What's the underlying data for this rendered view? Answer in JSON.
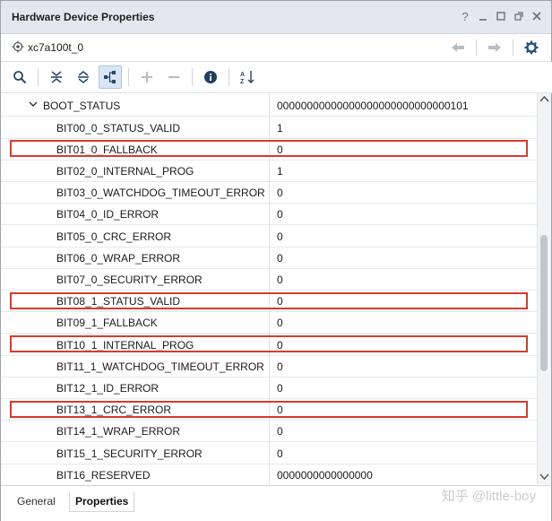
{
  "window": {
    "title": "Hardware Device Properties",
    "controls": [
      "?",
      "minimize",
      "restore",
      "float",
      "close"
    ],
    "controls_labels": {
      "help": "?"
    }
  },
  "device": {
    "name": "xc7a100t_0",
    "icon": "chip-icon"
  },
  "toolbar": {
    "buttons": [
      "search-icon",
      "collapse-all-icon",
      "expand-all-icon",
      "group-by-category-icon",
      "add-icon",
      "remove-icon",
      "info-icon",
      "sort-az-icon"
    ]
  },
  "properties": {
    "group": {
      "name": "BOOT_STATUS",
      "value": "00000000000000000000000000000101"
    },
    "rows": [
      {
        "name": "BIT00_0_STATUS_VALID",
        "value": "1",
        "highlighted": false
      },
      {
        "name": "BIT01_0_FALLBACK",
        "value": "0",
        "highlighted": true
      },
      {
        "name": "BIT02_0_INTERNAL_PROG",
        "value": "1",
        "highlighted": false
      },
      {
        "name": "BIT03_0_WATCHDOG_TIMEOUT_ERROR",
        "value": "0",
        "highlighted": false
      },
      {
        "name": "BIT04_0_ID_ERROR",
        "value": "0",
        "highlighted": false
      },
      {
        "name": "BIT05_0_CRC_ERROR",
        "value": "0",
        "highlighted": false
      },
      {
        "name": "BIT06_0_WRAP_ERROR",
        "value": "0",
        "highlighted": false
      },
      {
        "name": "BIT07_0_SECURITY_ERROR",
        "value": "0",
        "highlighted": false
      },
      {
        "name": "BIT08_1_STATUS_VALID",
        "value": "0",
        "highlighted": true
      },
      {
        "name": "BIT09_1_FALLBACK",
        "value": "0",
        "highlighted": false
      },
      {
        "name": "BIT10_1_INTERNAL_PROG",
        "value": "0",
        "highlighted": true
      },
      {
        "name": "BIT11_1_WATCHDOG_TIMEOUT_ERROR",
        "value": "0",
        "highlighted": false
      },
      {
        "name": "BIT12_1_ID_ERROR",
        "value": "0",
        "highlighted": false
      },
      {
        "name": "BIT13_1_CRC_ERROR",
        "value": "0",
        "highlighted": true
      },
      {
        "name": "BIT14_1_WRAP_ERROR",
        "value": "0",
        "highlighted": false
      },
      {
        "name": "BIT15_1_SECURITY_ERROR",
        "value": "0",
        "highlighted": false
      },
      {
        "name": "BIT16_RESERVED",
        "value": "0000000000000000",
        "highlighted": false
      }
    ]
  },
  "tabs": [
    {
      "label": "General",
      "active": false
    },
    {
      "label": "Properties",
      "active": true
    }
  ],
  "watermark": "知乎 @little-boy",
  "colors": {
    "highlight": "#d83a2e",
    "accent": "#1f5fa8",
    "titlebar": "#e4e8ee"
  }
}
